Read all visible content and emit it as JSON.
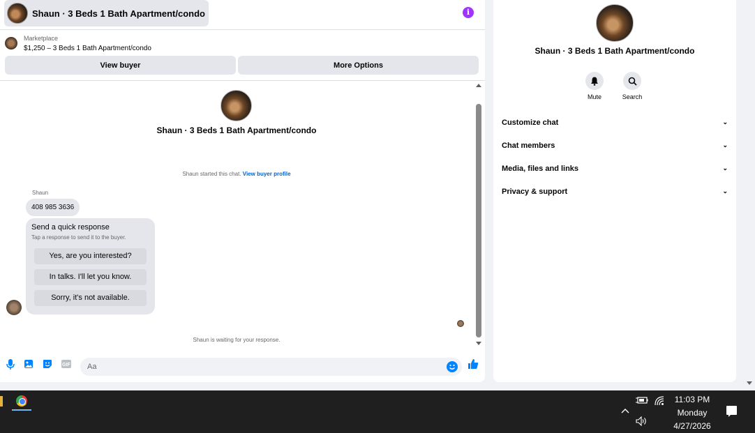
{
  "chat": {
    "header_title": "Shaun · 3 Beds 1 Bath Apartment/condo",
    "info_glyph": "i",
    "marketplace_label": "Marketplace",
    "listing": "$1,250 – 3 Beds 1 Bath Apartment/condo",
    "view_buyer": "View buyer",
    "more_options": "More Options",
    "thread_title": "Shaun · 3 Beds 1 Bath Apartment/condo",
    "started_text": "Shaun started this chat.",
    "view_buyer_profile": "View buyer profile",
    "sender_name": "Shaun",
    "phone_message": "408 985 3636",
    "quick_title": "Send a quick response",
    "quick_sub": "Tap a response to send it to the buyer.",
    "quick_responses": [
      "Yes, are you interested?",
      "In talks. I'll let you know.",
      "Sorry, it's not available."
    ],
    "waiting_text": "Shaun is waiting for your response.",
    "composer_placeholder": "Aa",
    "gif_label": "GIF"
  },
  "side": {
    "title": "Shaun · 3 Beds 1 Bath Apartment/condo",
    "mute_label": "Mute",
    "search_label": "Search",
    "menu": [
      "Customize chat",
      "Chat members",
      "Media, files and links",
      "Privacy & support"
    ]
  },
  "taskbar": {
    "time": "11:03 PM",
    "day": "Monday",
    "date": "4/27/2026"
  },
  "colors": {
    "accent": "#0084ff",
    "link": "#0064d1",
    "info": "#a033ff"
  }
}
